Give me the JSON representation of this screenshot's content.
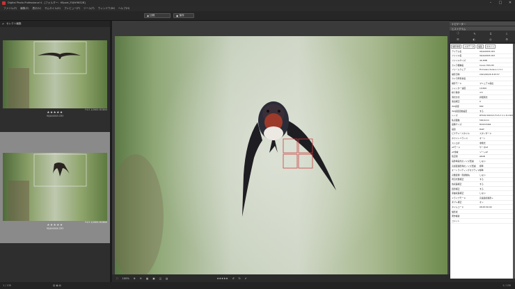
{
  "window": {
    "title": "Digital Photo Professional 4 - [フォルダー：¥Sport_FUJI¥9KS2B]"
  },
  "menu": [
    "ファイル(F)",
    "編集(E)",
    "表示(V)",
    "サムネイル(S)",
    "プレビュー(P)",
    "ツール(T)",
    "ウィンドウ(W)",
    "ヘルプ(H)"
  ],
  "toolbar": {
    "compare": "比較",
    "fit": "保存"
  },
  "left_panel": {
    "header": "セレクト編集",
    "thumbs": [
      {
        "caption": "9Q4A0003.CR3",
        "meta": [
          "F4.5",
          "1/1600",
          "ISO800"
        ],
        "stars": "★★★★★"
      },
      {
        "caption": "9Q4A0004.CR3",
        "meta": [
          "F4.5",
          "1/1600",
          "ISO800"
        ],
        "stars": "★★★★★"
      }
    ]
  },
  "bottom": {
    "zoom": "100%",
    "stars": "★★★★★"
  },
  "right_panel": {
    "header1": "ナビゲーター",
    "header2": "ヒストグラム",
    "tabs": [
      "撮影情報",
      "メタデータ",
      "編集",
      "ホワイト"
    ],
    "rows": [
      [
        "アイテム名",
        "9Q4A0003.CR3"
      ],
      [
        "ファイル名",
        "9Q4A0003.CR3"
      ],
      [
        "ファイルサイズ",
        "46.3MB"
      ],
      [
        "カメラ機種名",
        "Canon EOS R5"
      ],
      [
        "ファームウェア",
        "Firmware Version 1.3.1"
      ],
      [
        "撮影日時",
        "2021/06/26 8:45:57"
      ],
      [
        "カメラ所有者名",
        ""
      ],
      [
        "撮影モード",
        "マニュアル露出"
      ],
      [
        "シャッター速度",
        "1/1600"
      ],
      [
        "絞り数値",
        "4.5"
      ],
      [
        "測光方式",
        "評価測光"
      ],
      [
        "露出補正",
        "0"
      ],
      [
        "ISO感度",
        "800"
      ],
      [
        "ISO感度自動設定",
        "する"
      ],
      [
        "レンズ",
        "RF100-500mm F4.5-7.1 L IS USM"
      ],
      [
        "焦点距離",
        "500.0mm"
      ],
      [
        "画像サイズ",
        "8192x5464"
      ],
      [
        "画質",
        "RAW"
      ],
      [
        "ピクチャースタイル",
        "スタンダード"
      ],
      [
        "ホワイトバランス",
        "オート"
      ],
      [
        "ストロボ",
        "非発光"
      ],
      [
        "AFモード",
        "サーボAF"
      ],
      [
        "AF領域",
        "ゾーンAF"
      ],
      [
        "色空間",
        "sRGB"
      ],
      [
        "長秒時露光のノイズ低減",
        "しない"
      ],
      [
        "高感度撮影時のノイズ低減",
        "標準"
      ],
      [
        "オートライティングオプティマイザ",
        "標準"
      ],
      [
        "高輝度側・階調優先",
        "しない"
      ],
      [
        "周辺光量補正",
        "する"
      ],
      [
        "色収差補正",
        "する"
      ],
      [
        "回折補正",
        "する"
      ],
      [
        "歪曲収差補正",
        "しない"
      ],
      [
        "ドライブモード",
        "高速連続撮影+"
      ],
      [
        "手ブレ補正",
        "オン"
      ],
      [
        "タイムコード",
        "08:45:56:00"
      ],
      [
        "撮影者",
        ""
      ],
      [
        "著作権者",
        ""
      ],
      [
        "コメント",
        ""
      ]
    ]
  },
  "status": {
    "left": "1 / 130",
    "right": "1 / 130"
  }
}
